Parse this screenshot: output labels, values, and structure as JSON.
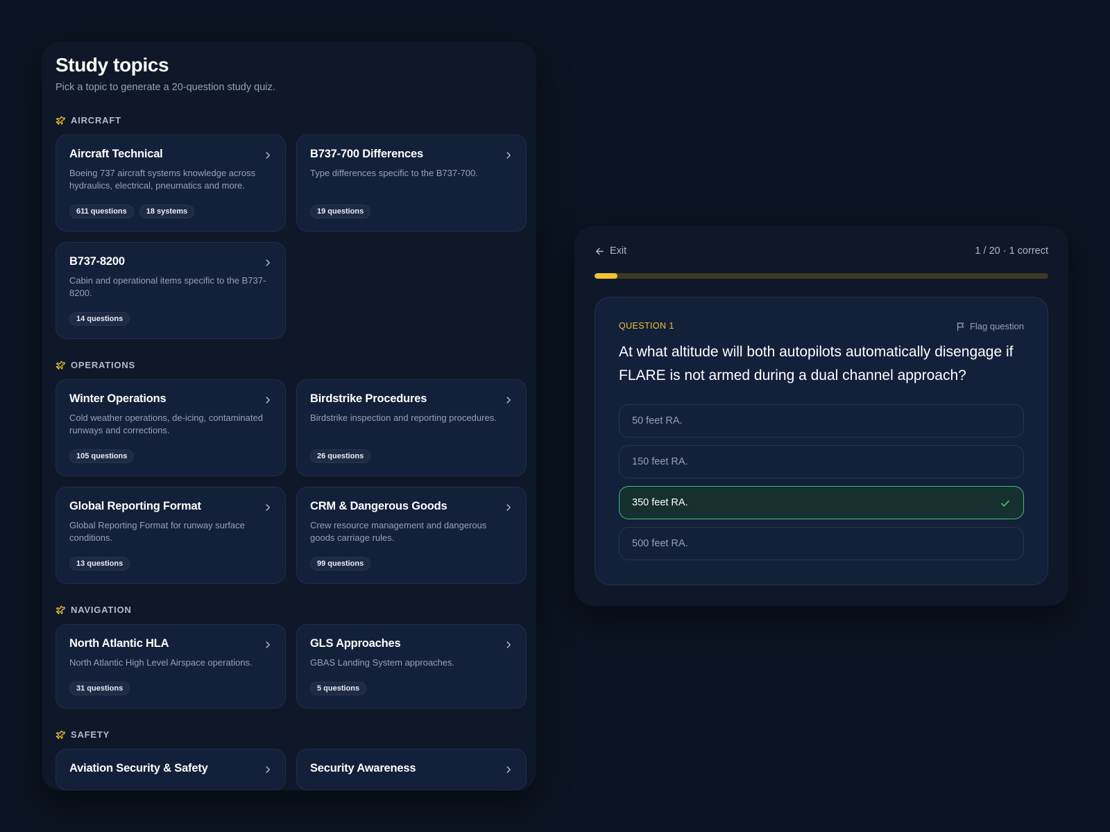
{
  "colors": {
    "background": "#0b1422",
    "panel": "#0e1828",
    "card": "#13203a",
    "accent": "#f2c230",
    "correct": "#3fc17a"
  },
  "study": {
    "title": "Study topics",
    "subtitle": "Pick a topic to generate a 20-question study quiz.",
    "section_icon": "plane-icon",
    "sections": [
      {
        "label": "AIRCRAFT",
        "topics": [
          {
            "title": "Aircraft Technical",
            "description": "Boeing 737 aircraft systems knowledge across hydraulics, electrical, pneumatics and more.",
            "badges": [
              "611 questions",
              "18 systems"
            ]
          },
          {
            "title": "B737-700 Differences",
            "description": "Type differences specific to the B737-700.",
            "badges": [
              "19 questions"
            ]
          },
          {
            "title": "B737-8200",
            "description": "Cabin and operational items specific to the B737-8200.",
            "badges": [
              "14 questions"
            ]
          }
        ]
      },
      {
        "label": "OPERATIONS",
        "topics": [
          {
            "title": "Winter Operations",
            "description": "Cold weather operations, de-icing, contaminated runways and corrections.",
            "badges": [
              "105 questions"
            ]
          },
          {
            "title": "Birdstrike Procedures",
            "description": "Birdstrike inspection and reporting procedures.",
            "badges": [
              "26 questions"
            ]
          },
          {
            "title": "Global Reporting Format",
            "description": "Global Reporting Format for runway surface conditions.",
            "badges": [
              "13 questions"
            ]
          },
          {
            "title": "CRM & Dangerous Goods",
            "description": "Crew resource management and dangerous goods carriage rules.",
            "badges": [
              "99 questions"
            ]
          }
        ]
      },
      {
        "label": "NAVIGATION",
        "topics": [
          {
            "title": "North Atlantic HLA",
            "description": "North Atlantic High Level Airspace operations.",
            "badges": [
              "31 questions"
            ]
          },
          {
            "title": "GLS Approaches",
            "description": "GBAS Landing System approaches.",
            "badges": [
              "5 questions"
            ]
          }
        ]
      },
      {
        "label": "SAFETY",
        "topics": [
          {
            "title": "Aviation Security & Safety",
            "description": "",
            "badges": []
          },
          {
            "title": "Security Awareness",
            "description": "",
            "badges": []
          }
        ]
      }
    ]
  },
  "quiz": {
    "exit_label": "Exit",
    "progress_text": "1 / 20 · 1 correct",
    "progress_fraction": 0.05,
    "question_label": "QUESTION 1",
    "flag_label": "Flag question",
    "question": "At what altitude will both autopilots automatically disengage if FLARE is not armed during a dual channel approach?",
    "options": [
      {
        "text": "50 feet RA.",
        "state": "default"
      },
      {
        "text": "150 feet RA.",
        "state": "default"
      },
      {
        "text": "350 feet RA.",
        "state": "correct"
      },
      {
        "text": "500 feet RA.",
        "state": "default"
      }
    ]
  }
}
